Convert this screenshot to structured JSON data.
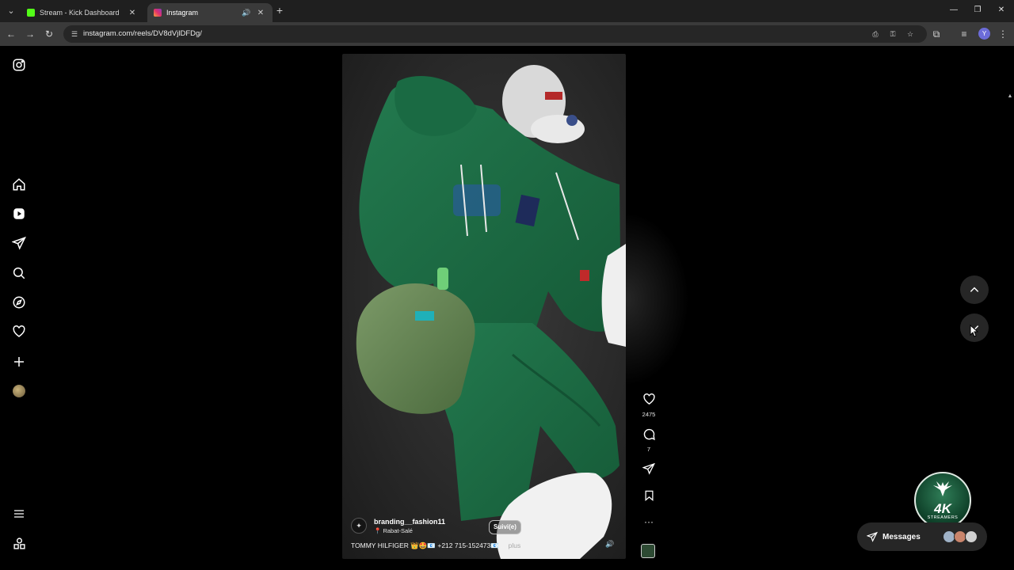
{
  "browser": {
    "tabs": [
      {
        "title": "Stream - Kick Dashboard",
        "favicon": "kick-icon",
        "color": "#53fc18"
      },
      {
        "title": "Instagram",
        "favicon": "instagram-icon",
        "color": "#e1306c"
      }
    ],
    "url": "instagram.com/reels/DV8dVjlDFDg/",
    "profile_initial": "Y"
  },
  "sidebar": {
    "items": [
      "instagram-logo",
      "home",
      "reels",
      "messages",
      "search",
      "explore",
      "notifications",
      "create",
      "profile",
      "more",
      "also-from-meta"
    ]
  },
  "reel": {
    "username": "branding__fashion11",
    "location": "Rabat-Salé",
    "follow_label": "Suivi(e)",
    "caption": "TOMMY HILFIGER 👑🤩📧 +212 715-152473📧 ...",
    "more_label": "plus",
    "likes": "2475",
    "comments": "7"
  },
  "messages": {
    "label": "Messages"
  },
  "watermark": {
    "big": "4K",
    "small": "STREAMERS"
  },
  "colors": {
    "background": "#000000",
    "panel": "#262626",
    "hoodie_green": "#1f6b46",
    "bag_green": "#5e7a4e"
  }
}
